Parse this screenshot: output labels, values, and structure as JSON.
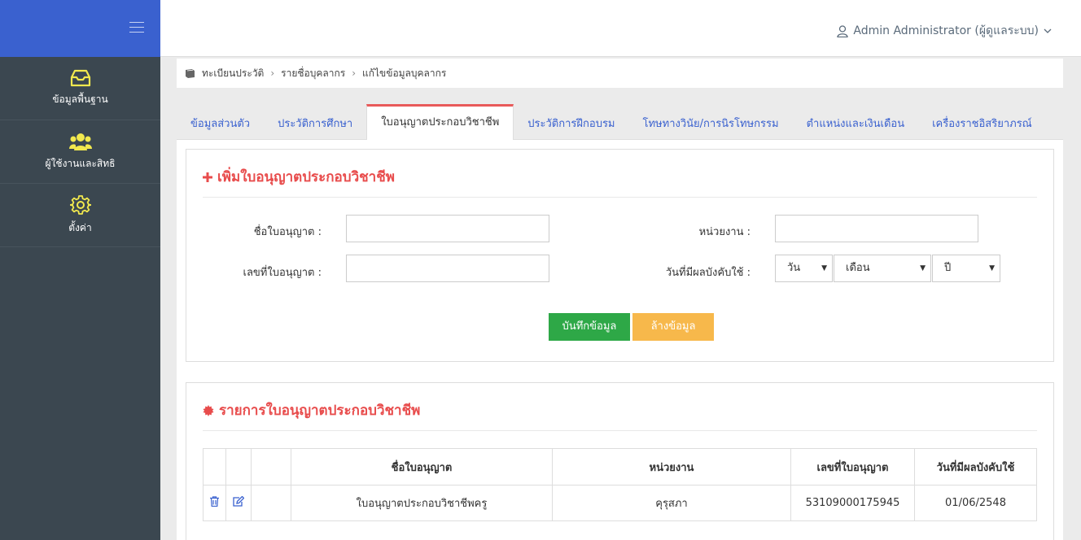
{
  "sidebar": {
    "items": [
      {
        "label": "ข้อมูลพื้นฐาน",
        "icon": "inbox-icon"
      },
      {
        "label": "ผู้ใช้งานและสิทธิ",
        "icon": "users-icon"
      },
      {
        "label": "ตั้งค่า",
        "icon": "gear-icon"
      }
    ],
    "accent_color": "#f2e94e"
  },
  "header": {
    "user_name": "Admin Administrator (ผู้ดูแลระบบ)"
  },
  "breadcrumb": [
    "ทะเบียนประวัติ",
    "รายชื่อบุคลากร",
    "แก้ไขข้อมูลบุคลากร"
  ],
  "tabs": [
    {
      "label": "ข้อมูลส่วนตัว"
    },
    {
      "label": "ประวัติการศึกษา"
    },
    {
      "label": "ใบอนุญาตประกอบวิชาชีพ",
      "active": true
    },
    {
      "label": "ประวัติการฝึกอบรม"
    },
    {
      "label": "โทษทางวินัย/การนิรโทษกรรม"
    },
    {
      "label": "ตำแหน่งและเงินเดือน"
    },
    {
      "label": "เครื่องราชอิสริยาภรณ์"
    }
  ],
  "form": {
    "title": "เพิ่มใบอนุญาตประกอบวิชาชีพ",
    "license_name_label": "ชื่อใบอนุญาต :",
    "license_name_value": "",
    "license_no_label": "เลขที่ใบอนุญาต :",
    "license_no_value": "",
    "agency_label": "หน่วยงาน :",
    "agency_value": "",
    "effective_date_label": "วันที่มีผลบังคับใช้ :",
    "day_select": "วัน",
    "month_select": "เดือน",
    "year_select": "ปี",
    "save_label": "บันทึกข้อมูล",
    "clear_label": "ล้างข้อมูล"
  },
  "list": {
    "title": "รายการใบอนุญาตประกอบวิชาชีพ",
    "columns": [
      "ชื่อใบอนุญาต",
      "หน่วยงาน",
      "เลขที่ใบอนุญาต",
      "วันที่มีผลบังคับใช้"
    ],
    "rows": [
      {
        "name": "ใบอนุญาตประกอบวิชาชีพครู",
        "agency": "คุรุสภา",
        "number": "53109000175945",
        "date": "01/06/2548"
      }
    ]
  },
  "colors": {
    "primary": "#3a61cf",
    "danger": "#e84c4c",
    "success": "#2ea847",
    "warning": "#f7b84b",
    "sidebar_bg": "#3b4750"
  }
}
